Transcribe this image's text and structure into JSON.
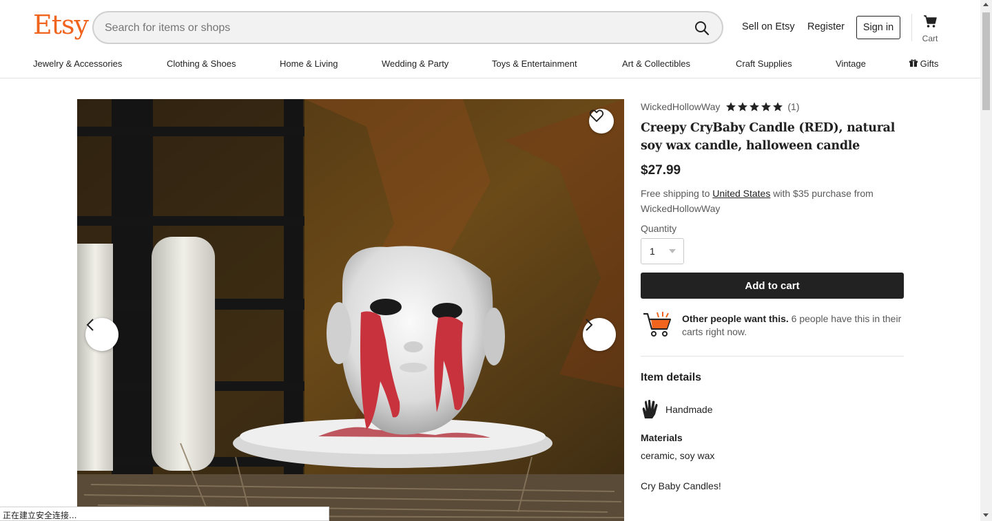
{
  "header": {
    "logo": "Etsy",
    "search_placeholder": "Search for items or shops",
    "sell_link": "Sell on Etsy",
    "register_link": "Register",
    "signin_button": "Sign in",
    "cart_label": "Cart"
  },
  "nav": {
    "items": [
      "Jewelry & Accessories",
      "Clothing & Shoes",
      "Home & Living",
      "Wedding & Party",
      "Toys & Entertainment",
      "Art & Collectibles",
      "Craft Supplies",
      "Vintage",
      "Gifts"
    ]
  },
  "listing": {
    "shop_name": "WickedHollowWay",
    "rating_stars": 5,
    "review_count": "(1)",
    "title": "Creepy CryBaby Candle (RED), natural soy wax candle, halloween candle",
    "price": "$27.99",
    "shipping_prefix": "Free shipping to ",
    "shipping_country": "United States",
    "shipping_suffix": " with $35 purchase from WickedHollowWay",
    "quantity_label": "Quantity",
    "quantity_value": "1",
    "add_to_cart": "Add to cart",
    "demand_bold": "Other people want this.",
    "demand_text": " 6 people have this in their carts right now.",
    "item_details_title": "Item details",
    "handmade_label": "Handmade",
    "materials_label": "Materials",
    "materials_value": "ceramic, soy wax",
    "description_start": "Cry Baby Candles!"
  },
  "status_bar": "正在建立安全连接...",
  "colors": {
    "brand": "#F1641E",
    "primary_button": "#222222",
    "demand_orange": "#F1641E"
  },
  "icons": [
    "search-icon",
    "cart-icon",
    "gift-icon",
    "heart-icon",
    "chevron-left-icon",
    "chevron-right-icon",
    "star-icon",
    "shopping-cart-demand-icon",
    "hand-icon"
  ]
}
